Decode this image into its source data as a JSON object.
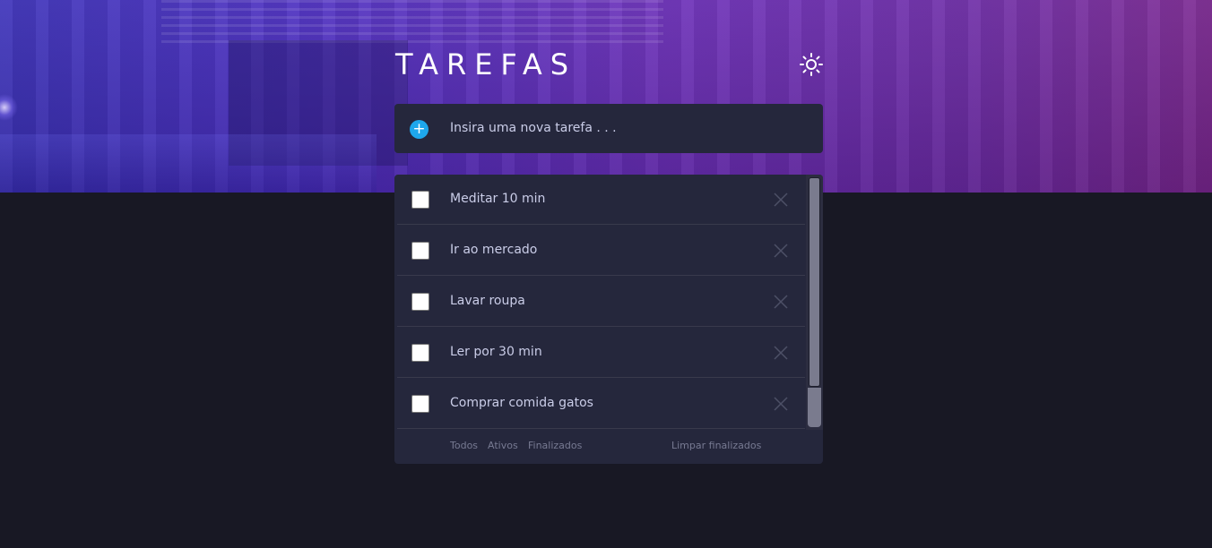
{
  "header": {
    "title": "TAREFAS",
    "theme_icon": "sun-icon"
  },
  "new_task": {
    "placeholder": "Insira uma nova tarefa . . .",
    "add_icon": "plus-icon",
    "value": ""
  },
  "tasks": [
    {
      "label": "Meditar 10 min",
      "completed": false
    },
    {
      "label": "Ir ao mercado",
      "completed": false
    },
    {
      "label": "Lavar roupa",
      "completed": false
    },
    {
      "label": "Ler por 30 min",
      "completed": false
    },
    {
      "label": "Comprar comida gatos",
      "completed": false
    }
  ],
  "footer": {
    "filter_all": "Todos",
    "filter_active": "Ativos",
    "filter_completed": "Finalizados",
    "clear_completed": "Limpar finalizados"
  },
  "colors": {
    "background": "#181824",
    "panel": "#25273c",
    "accent": "#1ea7ec",
    "text": "#cacde8",
    "muted": "#777a92"
  }
}
